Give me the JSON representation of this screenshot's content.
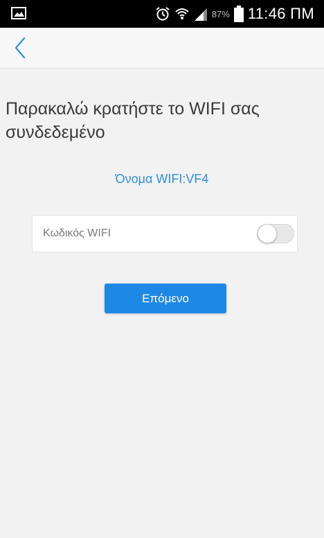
{
  "status_bar": {
    "battery_percent": "87%",
    "time": "11:46 ΠΜ",
    "icons": [
      "gallery-icon",
      "alarm-icon",
      "wifi-icon",
      "signal-icon",
      "battery-icon"
    ]
  },
  "nav": {
    "back_icon": "chevron-left-icon"
  },
  "main": {
    "title": "Παρακαλώ κρατήστε το WIFI σας συνδεδεμένο",
    "wifi_name": "Όνομα WIFI:VF4",
    "password_placeholder": "Κωδικός WIFI",
    "password_value": "",
    "show_password_toggle": false,
    "next_button_label": "Επόμενο"
  },
  "colors": {
    "accent": "#1e88e5",
    "link_text": "#2f8fdc",
    "background": "#f2f2f2"
  }
}
